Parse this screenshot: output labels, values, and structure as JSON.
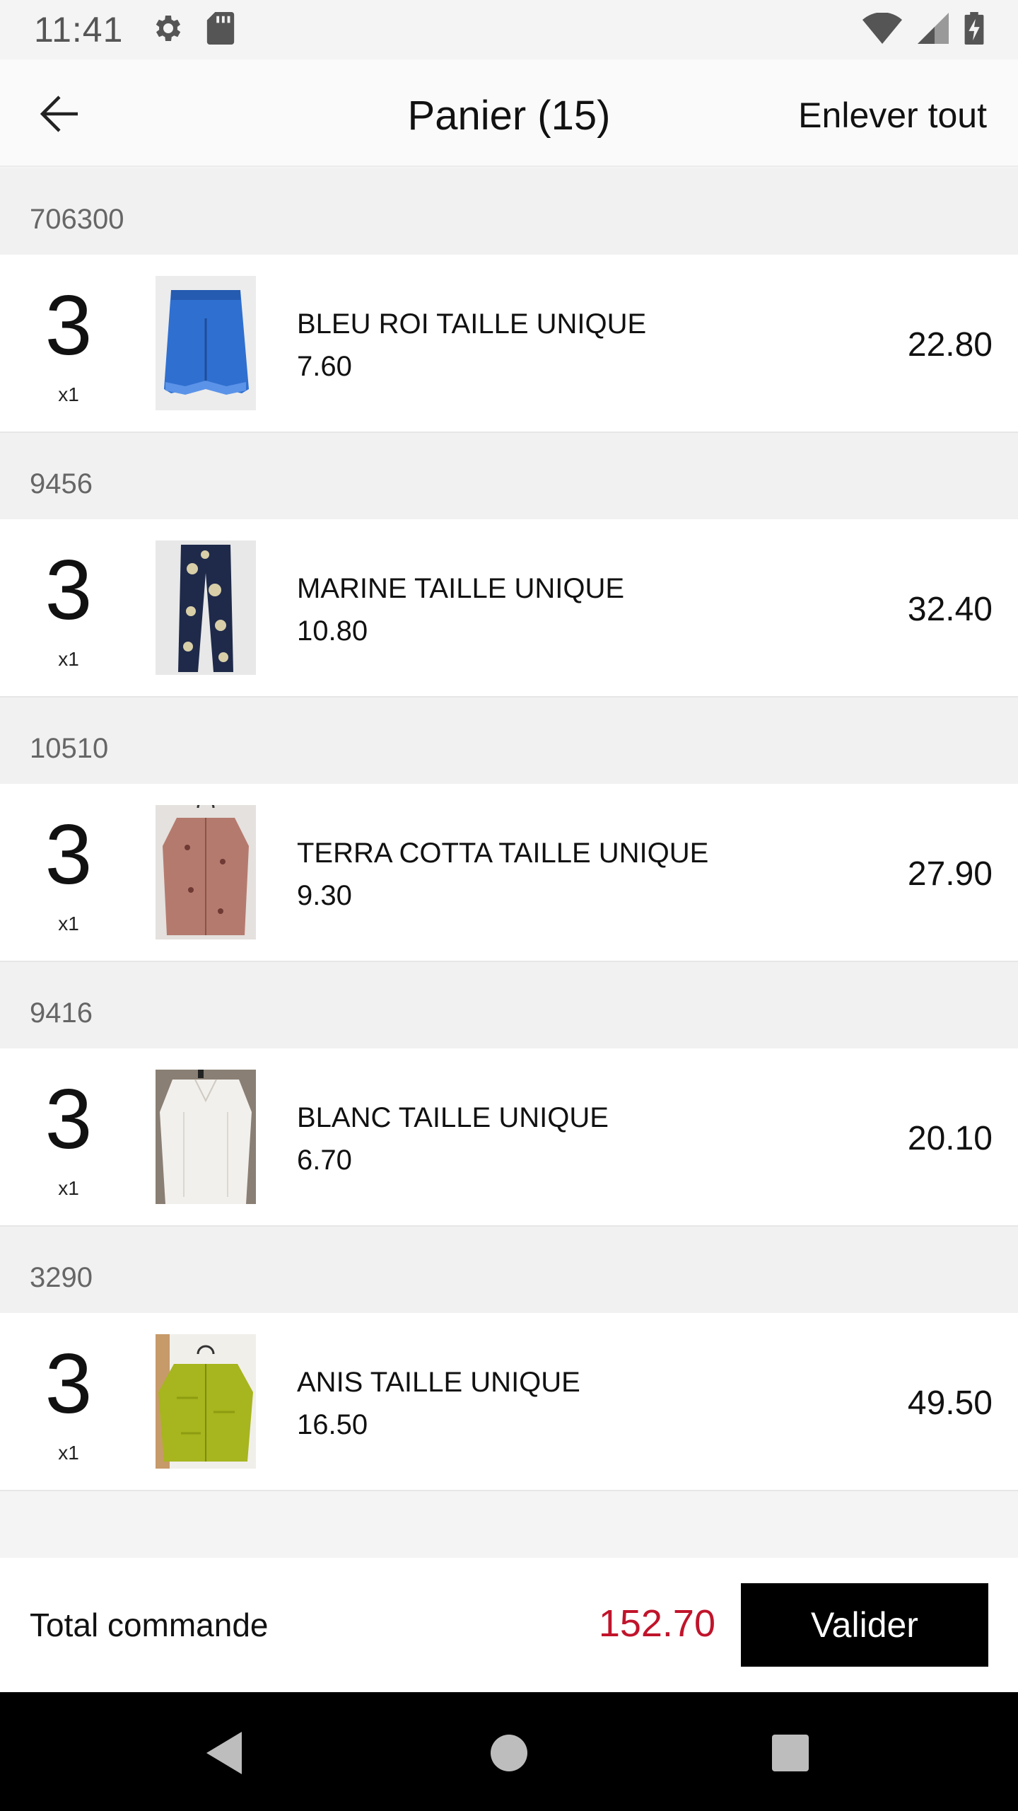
{
  "status_bar": {
    "time": "11:41",
    "left_icons": [
      "gear-icon",
      "sd-card-icon"
    ],
    "right_icons": [
      "wifi-icon",
      "cell-signal-icon",
      "battery-charging-icon"
    ]
  },
  "header": {
    "back_icon": "arrow-left-icon",
    "title": "Panier (15)",
    "clear_all_label": "Enlever tout"
  },
  "cart": {
    "groups": [
      {
        "ref": "706300",
        "qty": "3",
        "mult": "x1",
        "name": "BLEU ROI TAILLE UNIQUE",
        "unit_price": "7.60",
        "total": "22.80",
        "thumb_color": "#2f6fd0"
      },
      {
        "ref": "9456",
        "qty": "3",
        "mult": "x1",
        "name": "MARINE TAILLE UNIQUE",
        "unit_price": "10.80",
        "total": "32.40",
        "thumb_color": "#1f2a4a"
      },
      {
        "ref": "10510",
        "qty": "3",
        "mult": "x1",
        "name": "TERRA COTTA TAILLE UNIQUE",
        "unit_price": "9.30",
        "total": "27.90",
        "thumb_color": "#b57a6e"
      },
      {
        "ref": "9416",
        "qty": "3",
        "mult": "x1",
        "name": "BLANC TAILLE UNIQUE",
        "unit_price": "6.70",
        "total": "20.10",
        "thumb_color": "#f2f0ec"
      },
      {
        "ref": "3290",
        "qty": "3",
        "mult": "x1",
        "name": "ANIS TAILLE UNIQUE",
        "unit_price": "16.50",
        "total": "49.50",
        "thumb_color": "#a7b51e"
      }
    ]
  },
  "footer": {
    "total_label": "Total commande",
    "total_value": "152.70",
    "validate_label": "Valider"
  },
  "nav": {
    "icons": [
      "back-triangle-icon",
      "home-circle-icon",
      "recents-square-icon"
    ]
  },
  "colors": {
    "accent_total": "#c0142b",
    "button_bg": "#000000"
  }
}
